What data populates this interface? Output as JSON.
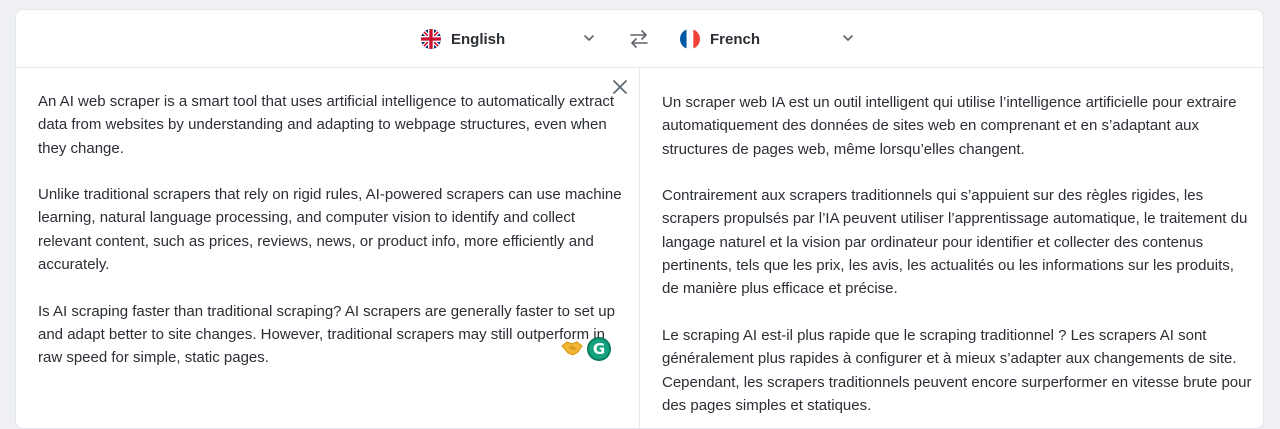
{
  "source_lang": {
    "label": "English",
    "flag_icon": "uk-flag-icon"
  },
  "target_lang": {
    "label": "French",
    "flag_icon": "france-flag-icon"
  },
  "icons": {
    "swap": "swap-arrows-icon",
    "clear": "close-icon",
    "chevron": "chevron-down-icon",
    "emoji": "handshake-emoji-icon",
    "grammarly": "grammarly-icon"
  },
  "grammarly_letter": "G",
  "source_text": [
    "An AI web scraper is a smart tool that uses artificial intelligence to automatically extract data from websites by understanding and adapting to webpage structures, even when they change.",
    "Unlike traditional scrapers that rely on rigid rules, AI-powered scrapers can use machine learning, natural language processing, and computer vision to identify and collect relevant content, such as prices, reviews, news, or product info, more efficiently and accurately.",
    "Is AI scraping faster than traditional scraping? AI scrapers are generally faster to set up and adapt better to site changes. However, traditional scrapers may still outperform in raw speed for simple, static pages."
  ],
  "translated_text": [
    "Un scraper web IA est un outil intelligent qui utilise l’intelligence artificielle pour extraire automatiquement des données de sites web en comprenant et en s’adaptant aux structures de pages web, même lorsqu’elles changent.",
    "Contrairement aux scrapers traditionnels qui s’appuient sur des règles rigides, les scrapers propulsés par l’IA peuvent utiliser l’apprentissage automatique, le traitement du langage naturel et la vision par ordinateur pour identifier et collecter des contenus pertinents, tels que les prix, les avis, les actualités ou les informations sur les produits, de manière plus efficace et précise.",
    "Le scraping AI est-il plus rapide que le scraping traditionnel ? Les scrapers AI sont généralement plus rapides à configurer et à mieux s’adapter aux changements de site. Cependant, les scrapers traditionnels peuvent encore surperformer en vitesse brute pour des pages simples et statiques."
  ],
  "colors": {
    "accent_green": "#15a37f",
    "page_bg": "#eef0f3",
    "text": "#2a2e35"
  }
}
